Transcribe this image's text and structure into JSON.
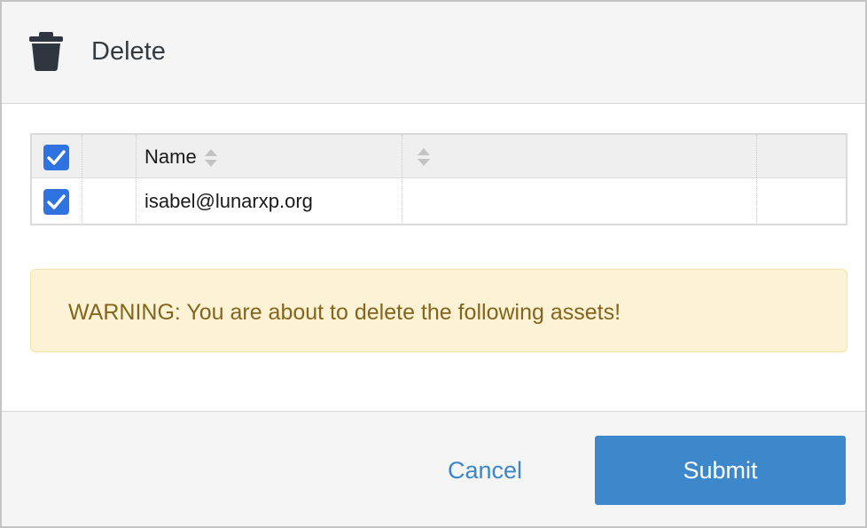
{
  "dialog": {
    "title": "Delete",
    "icon": "trash-icon"
  },
  "table": {
    "columns": [
      {
        "label": "",
        "type": "select-all-checkbox",
        "checked": true
      },
      {
        "label": ""
      },
      {
        "label": "Name",
        "sortable": true
      },
      {
        "label": "",
        "sortable": true
      },
      {
        "label": ""
      }
    ],
    "rows": [
      {
        "checked": true,
        "name": "isabel@lunarxp.org",
        "extra": ""
      }
    ]
  },
  "warning": {
    "text": "WARNING: You are about to delete the following assets!"
  },
  "footer": {
    "cancel_label": "Cancel",
    "submit_label": "Submit"
  },
  "colors": {
    "accent": "#3c88cb",
    "checkbox": "#2f73e0",
    "warning_bg": "#fcf3d6",
    "warning_text": "#85641b"
  }
}
